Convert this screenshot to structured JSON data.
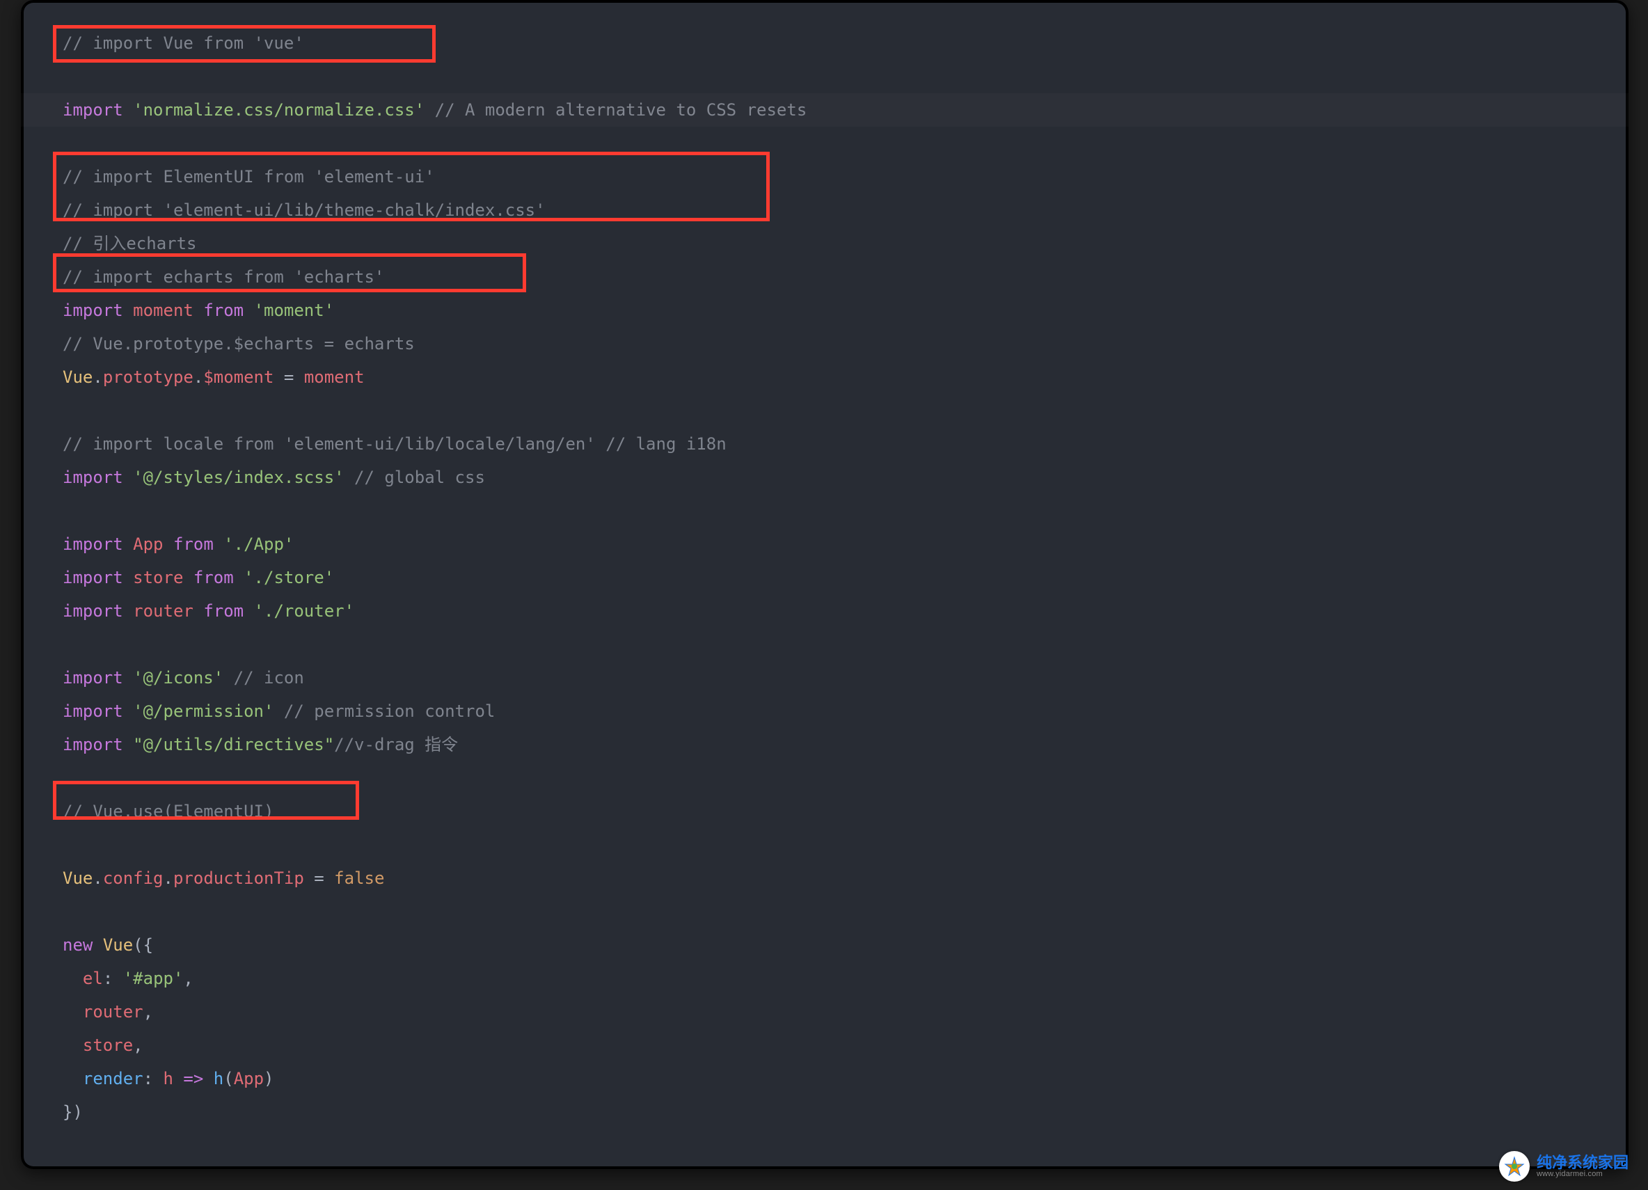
{
  "watermark": {
    "zh": "纯净系统家园",
    "en": "www.yidarmei.com"
  },
  "code": {
    "lines": [
      {
        "highlight": false,
        "tokens": [
          {
            "cls": "tok-comment",
            "t": "// import Vue from 'vue'"
          }
        ]
      },
      {
        "highlight": false,
        "tokens": []
      },
      {
        "highlight": true,
        "tokens": [
          {
            "cls": "tok-keyword",
            "t": "import"
          },
          {
            "cls": "tok-plain",
            "t": " "
          },
          {
            "cls": "tok-string",
            "t": "'normalize.css/normalize.css'"
          },
          {
            "cls": "tok-plain",
            "t": " "
          },
          {
            "cls": "tok-comment",
            "t": "// A modern alternative to CSS resets"
          }
        ]
      },
      {
        "highlight": false,
        "tokens": []
      },
      {
        "highlight": false,
        "tokens": [
          {
            "cls": "tok-comment",
            "t": "// import ElementUI from 'element-ui'"
          }
        ]
      },
      {
        "highlight": false,
        "tokens": [
          {
            "cls": "tok-comment",
            "t": "// import 'element-ui/lib/theme-chalk/index.css'"
          }
        ]
      },
      {
        "highlight": false,
        "tokens": [
          {
            "cls": "tok-comment",
            "t": "// 引入echarts"
          }
        ]
      },
      {
        "highlight": false,
        "tokens": [
          {
            "cls": "tok-comment",
            "t": "// import echarts from 'echarts'"
          }
        ]
      },
      {
        "highlight": false,
        "tokens": [
          {
            "cls": "tok-keyword",
            "t": "import"
          },
          {
            "cls": "tok-plain",
            "t": " "
          },
          {
            "cls": "tok-ident",
            "t": "moment"
          },
          {
            "cls": "tok-plain",
            "t": " "
          },
          {
            "cls": "tok-keyword",
            "t": "from"
          },
          {
            "cls": "tok-plain",
            "t": " "
          },
          {
            "cls": "tok-string",
            "t": "'moment'"
          }
        ]
      },
      {
        "highlight": false,
        "tokens": [
          {
            "cls": "tok-comment",
            "t": "// Vue.prototype.$echarts = echarts"
          }
        ]
      },
      {
        "highlight": false,
        "tokens": [
          {
            "cls": "tok-prop",
            "t": "Vue"
          },
          {
            "cls": "tok-punct",
            "t": "."
          },
          {
            "cls": "tok-ident",
            "t": "prototype"
          },
          {
            "cls": "tok-punct",
            "t": "."
          },
          {
            "cls": "tok-ident",
            "t": "$moment"
          },
          {
            "cls": "tok-plain",
            "t": " "
          },
          {
            "cls": "tok-punct",
            "t": "="
          },
          {
            "cls": "tok-plain",
            "t": " "
          },
          {
            "cls": "tok-ident",
            "t": "moment"
          }
        ]
      },
      {
        "highlight": false,
        "tokens": []
      },
      {
        "highlight": false,
        "tokens": [
          {
            "cls": "tok-comment",
            "t": "// import locale from 'element-ui/lib/locale/lang/en' // lang i18n"
          }
        ]
      },
      {
        "highlight": false,
        "tokens": [
          {
            "cls": "tok-keyword",
            "t": "import"
          },
          {
            "cls": "tok-plain",
            "t": " "
          },
          {
            "cls": "tok-string",
            "t": "'@/styles/index.scss'"
          },
          {
            "cls": "tok-plain",
            "t": " "
          },
          {
            "cls": "tok-comment",
            "t": "// global css"
          }
        ]
      },
      {
        "highlight": false,
        "tokens": []
      },
      {
        "highlight": false,
        "tokens": [
          {
            "cls": "tok-keyword",
            "t": "import"
          },
          {
            "cls": "tok-plain",
            "t": " "
          },
          {
            "cls": "tok-ident",
            "t": "App"
          },
          {
            "cls": "tok-plain",
            "t": " "
          },
          {
            "cls": "tok-keyword",
            "t": "from"
          },
          {
            "cls": "tok-plain",
            "t": " "
          },
          {
            "cls": "tok-string",
            "t": "'./App'"
          }
        ]
      },
      {
        "highlight": false,
        "tokens": [
          {
            "cls": "tok-keyword",
            "t": "import"
          },
          {
            "cls": "tok-plain",
            "t": " "
          },
          {
            "cls": "tok-ident",
            "t": "store"
          },
          {
            "cls": "tok-plain",
            "t": " "
          },
          {
            "cls": "tok-keyword",
            "t": "from"
          },
          {
            "cls": "tok-plain",
            "t": " "
          },
          {
            "cls": "tok-string",
            "t": "'./store'"
          }
        ]
      },
      {
        "highlight": false,
        "tokens": [
          {
            "cls": "tok-keyword",
            "t": "import"
          },
          {
            "cls": "tok-plain",
            "t": " "
          },
          {
            "cls": "tok-ident",
            "t": "router"
          },
          {
            "cls": "tok-plain",
            "t": " "
          },
          {
            "cls": "tok-keyword",
            "t": "from"
          },
          {
            "cls": "tok-plain",
            "t": " "
          },
          {
            "cls": "tok-string",
            "t": "'./router'"
          }
        ]
      },
      {
        "highlight": false,
        "tokens": []
      },
      {
        "highlight": false,
        "tokens": [
          {
            "cls": "tok-keyword",
            "t": "import"
          },
          {
            "cls": "tok-plain",
            "t": " "
          },
          {
            "cls": "tok-string",
            "t": "'@/icons'"
          },
          {
            "cls": "tok-plain",
            "t": " "
          },
          {
            "cls": "tok-comment",
            "t": "// icon"
          }
        ]
      },
      {
        "highlight": false,
        "tokens": [
          {
            "cls": "tok-keyword",
            "t": "import"
          },
          {
            "cls": "tok-plain",
            "t": " "
          },
          {
            "cls": "tok-string",
            "t": "'@/permission'"
          },
          {
            "cls": "tok-plain",
            "t": " "
          },
          {
            "cls": "tok-comment",
            "t": "// permission control"
          }
        ]
      },
      {
        "highlight": false,
        "tokens": [
          {
            "cls": "tok-keyword",
            "t": "import"
          },
          {
            "cls": "tok-plain",
            "t": " "
          },
          {
            "cls": "tok-string",
            "t": "\"@/utils/directives\""
          },
          {
            "cls": "tok-comment",
            "t": "//v-drag 指令"
          }
        ]
      },
      {
        "highlight": false,
        "tokens": []
      },
      {
        "highlight": false,
        "tokens": [
          {
            "cls": "tok-comment",
            "t": "// Vue.use(ElementUI)"
          }
        ]
      },
      {
        "highlight": false,
        "tokens": []
      },
      {
        "highlight": false,
        "tokens": [
          {
            "cls": "tok-prop",
            "t": "Vue"
          },
          {
            "cls": "tok-punct",
            "t": "."
          },
          {
            "cls": "tok-ident",
            "t": "config"
          },
          {
            "cls": "tok-punct",
            "t": "."
          },
          {
            "cls": "tok-ident",
            "t": "productionTip"
          },
          {
            "cls": "tok-plain",
            "t": " "
          },
          {
            "cls": "tok-punct",
            "t": "="
          },
          {
            "cls": "tok-plain",
            "t": " "
          },
          {
            "cls": "tok-const",
            "t": "false"
          }
        ]
      },
      {
        "highlight": false,
        "tokens": []
      },
      {
        "highlight": false,
        "tokens": [
          {
            "cls": "tok-keyword",
            "t": "new"
          },
          {
            "cls": "tok-plain",
            "t": " "
          },
          {
            "cls": "tok-prop",
            "t": "Vue"
          },
          {
            "cls": "tok-punct",
            "t": "({"
          }
        ]
      },
      {
        "highlight": false,
        "tokens": [
          {
            "cls": "tok-plain",
            "t": "  "
          },
          {
            "cls": "tok-ident",
            "t": "el"
          },
          {
            "cls": "tok-punct",
            "t": ": "
          },
          {
            "cls": "tok-string",
            "t": "'#app'"
          },
          {
            "cls": "tok-punct",
            "t": ","
          }
        ]
      },
      {
        "highlight": false,
        "tokens": [
          {
            "cls": "tok-plain",
            "t": "  "
          },
          {
            "cls": "tok-ident",
            "t": "router"
          },
          {
            "cls": "tok-punct",
            "t": ","
          }
        ]
      },
      {
        "highlight": false,
        "tokens": [
          {
            "cls": "tok-plain",
            "t": "  "
          },
          {
            "cls": "tok-ident",
            "t": "store"
          },
          {
            "cls": "tok-punct",
            "t": ","
          }
        ]
      },
      {
        "highlight": false,
        "tokens": [
          {
            "cls": "tok-plain",
            "t": "  "
          },
          {
            "cls": "tok-func",
            "t": "render"
          },
          {
            "cls": "tok-punct",
            "t": ": "
          },
          {
            "cls": "tok-ident",
            "t": "h"
          },
          {
            "cls": "tok-plain",
            "t": " "
          },
          {
            "cls": "tok-keyword",
            "t": "=>"
          },
          {
            "cls": "tok-plain",
            "t": " "
          },
          {
            "cls": "tok-func",
            "t": "h"
          },
          {
            "cls": "tok-punct",
            "t": "("
          },
          {
            "cls": "tok-ident",
            "t": "App"
          },
          {
            "cls": "tok-punct",
            "t": ")"
          }
        ]
      },
      {
        "highlight": false,
        "tokens": [
          {
            "cls": "tok-punct",
            "t": "})"
          }
        ]
      }
    ]
  }
}
